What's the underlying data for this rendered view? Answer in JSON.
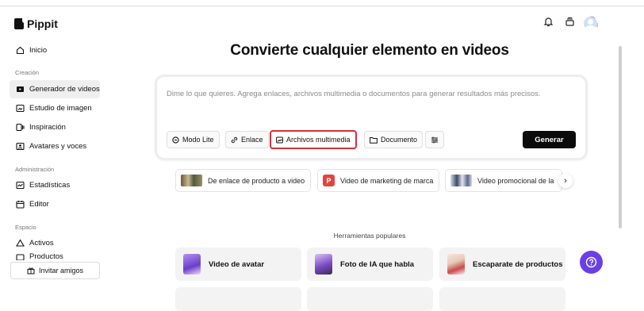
{
  "app": {
    "name": "Pippit"
  },
  "sidebar": {
    "home": "Inicio",
    "sections": [
      {
        "label": "Creación",
        "items": [
          "Generador de videos",
          "Estudio de imagen",
          "Inspiración",
          "Avatares y voces"
        ]
      },
      {
        "label": "Administración",
        "items": [
          "Estadísticas",
          "Editor"
        ]
      },
      {
        "label": "Espacio",
        "items": [
          "Activos",
          "Productos"
        ]
      }
    ],
    "active_item": "Generador de videos",
    "invite_label": "Invitar amigos"
  },
  "main": {
    "title": "Convierte cualquier elemento en videos",
    "prompt_placeholder": "Dime lo que quieres. Agrega enlaces, archivos multimedia o documentos para generar resultados más precisos.",
    "chips": {
      "lite": "Modo Lite",
      "link": "Enlace",
      "media": "Archivos multimedia",
      "document": "Documento"
    },
    "generate_label": "Generar",
    "suggestions": [
      "De enlace de producto a video",
      "Video de marketing de marca",
      "Video promocional de la"
    ],
    "suggestion_badge": "P",
    "tools_heading": "Herramientas populares",
    "tools": [
      "Video de avatar",
      "Foto de IA que habla",
      "Escaparate de productos"
    ]
  },
  "colors": {
    "accent": "#6b3fe6",
    "highlight": "#d6303a",
    "primary_button": "#0b0b0b"
  }
}
